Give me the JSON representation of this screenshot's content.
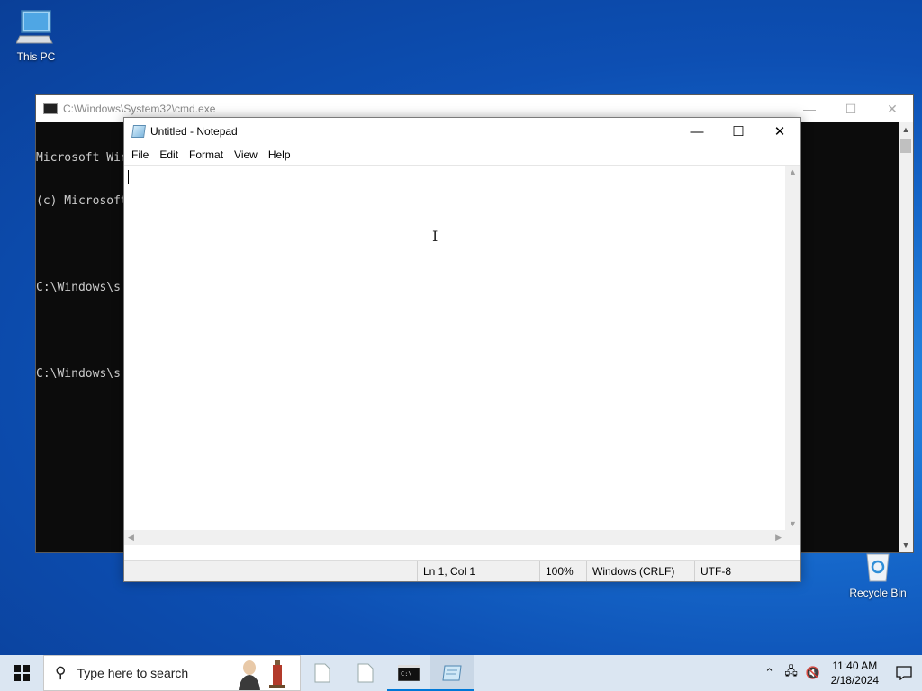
{
  "desktop": {
    "icons": [
      {
        "label": "This PC",
        "icon": "computer-icon"
      },
      {
        "label": "Recycle Bin",
        "icon": "recycle-bin-icon"
      }
    ]
  },
  "cmd": {
    "title": "C:\\Windows\\System32\\cmd.exe",
    "lines": [
      "Microsoft Win",
      "(c) Microsoft",
      "",
      "C:\\Windows\\s",
      "",
      "C:\\Windows\\s"
    ],
    "controls": {
      "minimize": "—",
      "maximize": "☐",
      "close": "✕"
    }
  },
  "notepad": {
    "title": "Untitled - Notepad",
    "menu": [
      "File",
      "Edit",
      "Format",
      "View",
      "Help"
    ],
    "content": "",
    "controls": {
      "minimize": "—",
      "maximize": "☐",
      "close": "✕"
    },
    "status": {
      "position": "Ln 1, Col 1",
      "zoom": "100%",
      "line_ending": "Windows (CRLF)",
      "encoding": "UTF-8"
    }
  },
  "taskbar": {
    "search_placeholder": "Type here to search",
    "apps": [
      {
        "name": "file-app-1",
        "icon": "file-icon"
      },
      {
        "name": "file-app-2",
        "icon": "file-icon"
      },
      {
        "name": "cmd-app",
        "icon": "terminal-icon"
      },
      {
        "name": "notepad-app",
        "icon": "notepad-icon"
      }
    ],
    "tray": {
      "time": "11:40 AM",
      "date": "2/18/2024"
    }
  },
  "colors": {
    "accent": "#0078d7",
    "taskbar": "#dbe6f2",
    "cmd_bg": "#0c0c0c"
  }
}
